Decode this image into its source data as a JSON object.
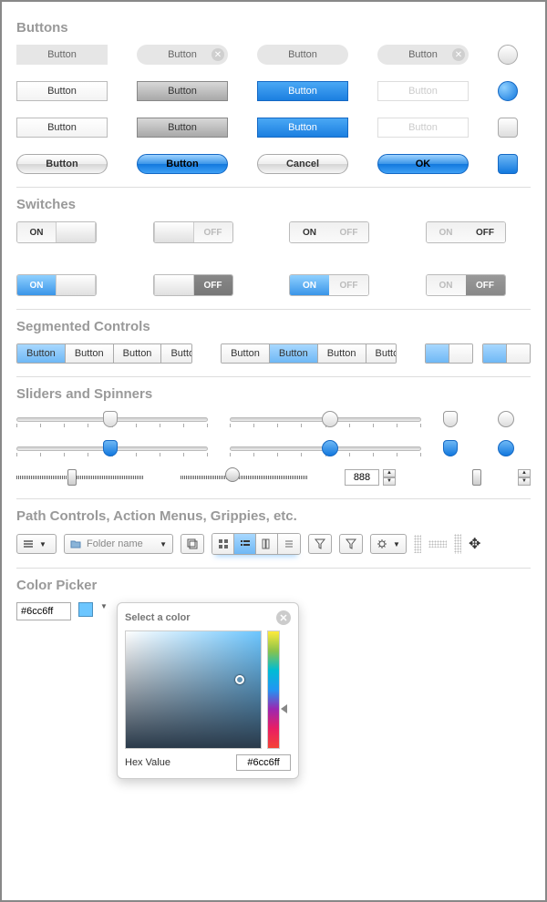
{
  "sections": {
    "buttons": "Buttons",
    "switches": "Switches",
    "segmented": "Segmented Controls",
    "sliders": "Sliders and Spinners",
    "path": "Path Controls, Action Menus, Grippies, etc.",
    "colorpicker": "Color Picker"
  },
  "buttons": {
    "label": "Button",
    "cancel": "Cancel",
    "ok": "OK"
  },
  "switches": {
    "on": "ON",
    "off": "OFF"
  },
  "segmented": {
    "label": "Button"
  },
  "spinner": {
    "value": "888"
  },
  "path": {
    "folder_placeholder": "Folder name"
  },
  "colorpicker": {
    "value": "#6cc6ff",
    "panel_title": "Select a color",
    "hex_label": "Hex Value",
    "hex_value": "#6cc6ff"
  },
  "colors": {
    "accent_blue": "#1278de",
    "light_blue": "#6cc6ff"
  }
}
